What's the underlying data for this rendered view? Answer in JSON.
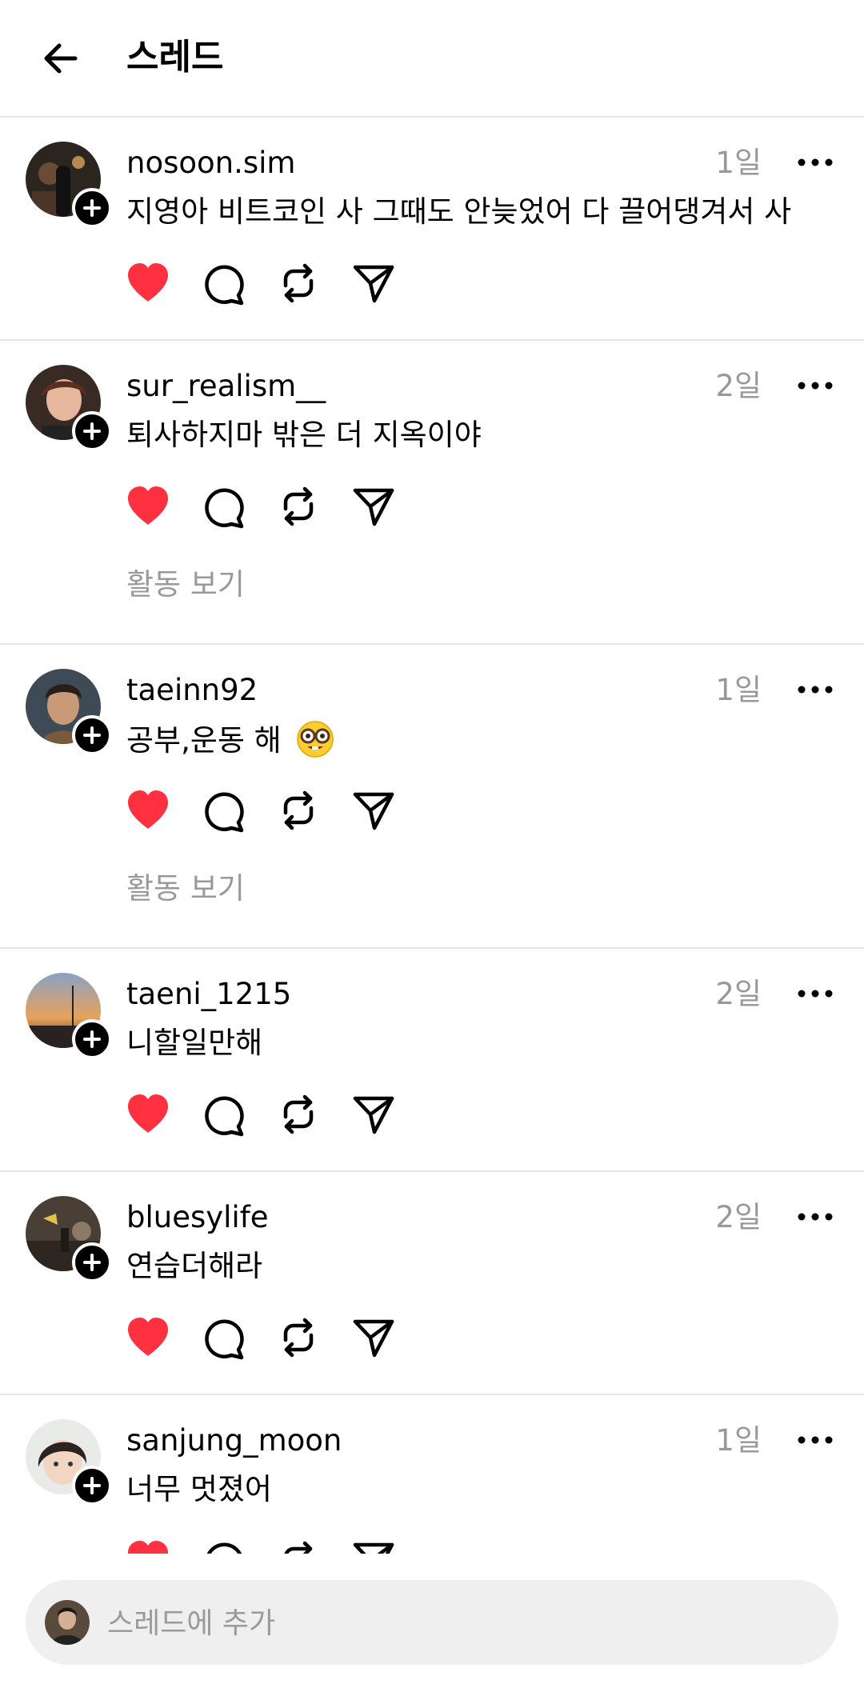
{
  "header": {
    "title": "스레드",
    "back_icon": "arrow-left-icon"
  },
  "posts": [
    {
      "username": "nosoon.sim",
      "time": "1일",
      "text": "지영아 비트코인 사 그때도 안늦었어 다 끌어댕겨서 사",
      "liked": true,
      "activity_label": ""
    },
    {
      "username": "sur_realism__",
      "time": "2일",
      "text": "퇴사하지마 밖은 더 지옥이야",
      "liked": true,
      "activity_label": "활동 보기"
    },
    {
      "username": "taeinn92",
      "time": "1일",
      "text": "공부,운동 해",
      "emoji": "nerd-face-emoji",
      "liked": true,
      "activity_label": "활동 보기"
    },
    {
      "username": "taeni_1215",
      "time": "2일",
      "text": "니할일만해",
      "liked": true,
      "activity_label": ""
    },
    {
      "username": "bluesylife",
      "time": "2일",
      "text": "연습더해라",
      "liked": true,
      "activity_label": ""
    },
    {
      "username": "sanjung_moon",
      "time": "1일",
      "text": "너무 멋졌어",
      "liked": true,
      "activity_label": ""
    }
  ],
  "composer": {
    "placeholder": "스레드에 추가"
  },
  "colors": {
    "like": "#ff3040",
    "secondary_text": "#999999",
    "divider": "#e6e6e6",
    "composer_bg": "#efefef"
  }
}
